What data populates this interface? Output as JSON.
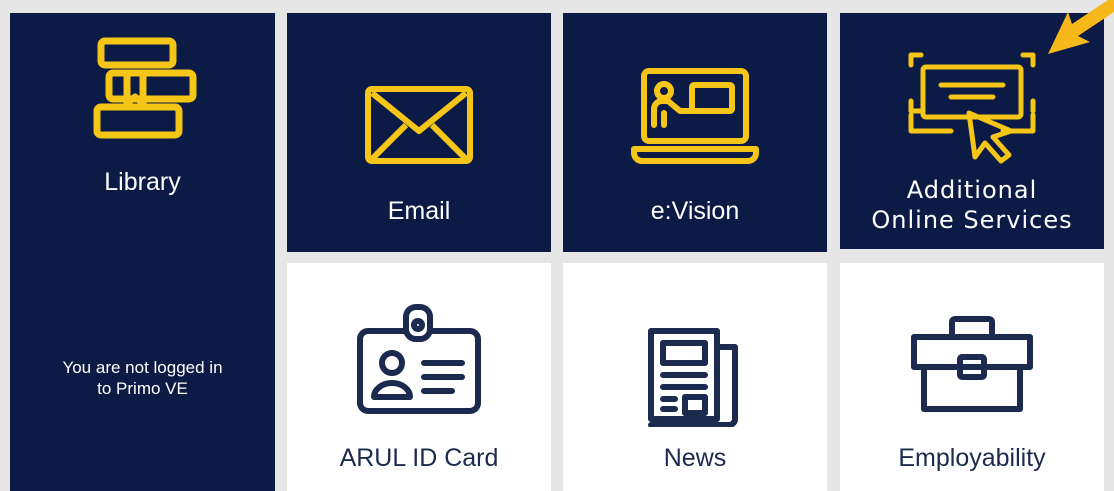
{
  "tiles": {
    "library": {
      "label": "Library",
      "icon": "books-icon"
    },
    "email": {
      "label": "Email",
      "icon": "envelope-icon"
    },
    "evision": {
      "label": "e:Vision",
      "icon": "laptop-presenter-icon"
    },
    "additional": {
      "label_line1": "Additional",
      "label_line2": "Online Services",
      "icon": "online-form-cursor-icon"
    },
    "id_card": {
      "label": "ARUL ID Card",
      "icon": "id-badge-icon"
    },
    "news": {
      "label": "News",
      "icon": "newspaper-icon"
    },
    "employability": {
      "label": "Employability",
      "icon": "briefcase-icon"
    }
  },
  "library_status": {
    "line1": "You are not logged in",
    "line2": "to Primo VE"
  },
  "colors": {
    "navy": "#0b1b45",
    "accent": "#f5c518",
    "arrow": "#f6b81a",
    "background": "#e6e6e6",
    "icon_dark": "#1b2a4e"
  }
}
